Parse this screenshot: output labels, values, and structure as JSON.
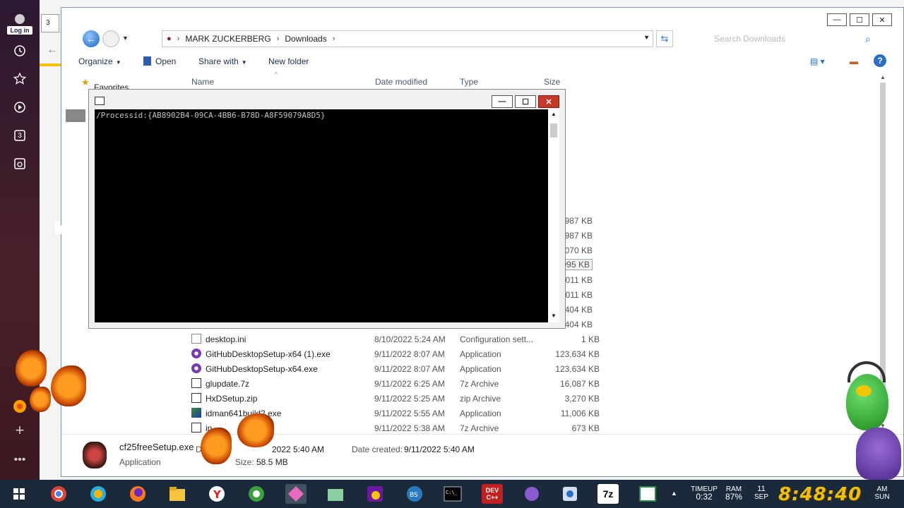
{
  "browser": {
    "tab_number": "3",
    "login_label": "Log in",
    "sidebar_badge": "3"
  },
  "explorer": {
    "title_buttons": {
      "minimize": "—",
      "maximize": "☐",
      "close": "✕"
    },
    "breadcrumbs": [
      "MARK ZUCKERBERG",
      "Downloads"
    ],
    "search_placeholder": "Search Downloads",
    "toolbar": {
      "organize": "Organize",
      "open": "Open",
      "share_with": "Share with",
      "new_folder": "New folder"
    },
    "nav_pane": {
      "favorites": "Favorites"
    },
    "columns": {
      "name": "Name",
      "date": "Date modified",
      "type": "Type",
      "size": "Size"
    },
    "partial_sizes": [
      "987 KB",
      "987 KB",
      "070 KB",
      "995 KB",
      "011 KB",
      "011 KB",
      "404 KB",
      "404 KB"
    ],
    "files": [
      {
        "name": "desktop.ini",
        "date": "8/10/2022 5:24 AM",
        "type": "Configuration sett...",
        "size": "1 KB",
        "icon": "ini-file-icon"
      },
      {
        "name": "GitHubDesktopSetup-x64 (1).exe",
        "date": "9/11/2022 8:07 AM",
        "type": "Application",
        "size": "123,634 KB",
        "icon": "github-icon"
      },
      {
        "name": "GitHubDesktopSetup-x64.exe",
        "date": "9/11/2022 8:07 AM",
        "type": "Application",
        "size": "123,634 KB",
        "icon": "github-icon"
      },
      {
        "name": "glupdate.7z",
        "date": "9/11/2022 6:25 AM",
        "type": "7z Archive",
        "size": "16,087 KB",
        "icon": "archive-icon"
      },
      {
        "name": "HxDSetup.zip",
        "date": "9/11/2022 5:25 AM",
        "type": "zip Archive",
        "size": "3,270 KB",
        "icon": "archive-icon"
      },
      {
        "name": "idman641build2.exe",
        "date": "9/11/2022 5:55 AM",
        "type": "Application",
        "size": "11,006 KB",
        "icon": "idm-icon"
      },
      {
        "name": "in",
        "date": "9/11/2022 5:38 AM",
        "type": "7z Archive",
        "size": "673 KB",
        "icon": "archive-icon"
      }
    ],
    "details": {
      "filename": "cf25freeSetup.exe",
      "filetype": "Application",
      "date_modified_label": "Da",
      "date_modified_value": "2022 5:40 AM",
      "size_label": "Size:",
      "size_value": "58.5 MB",
      "date_created_label": "Date created:",
      "date_created_value": "9/11/2022 5:40 AM"
    }
  },
  "console": {
    "text": "/Processid:{AB8902B4-09CA-4BB6-B78D-A8F59079A8D5}",
    "buttons": {
      "minimize": "—",
      "maximize": "☐",
      "close": "✕"
    }
  },
  "taskbar": {
    "dev_label": "DEV\nC++",
    "zip_label": "7z",
    "timeup_label": "TIMEUP",
    "timeup_value": "0:32",
    "ram_label": "RAM",
    "ram_value": "87%",
    "date_day": "11",
    "date_month": "SEP",
    "clock": "8:48:40",
    "ampm": "AM",
    "weekday": "SUN"
  }
}
